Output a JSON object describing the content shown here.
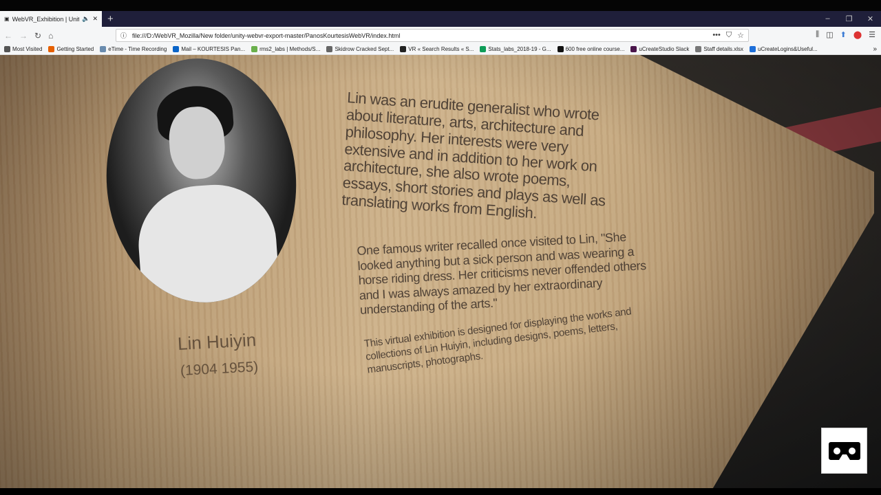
{
  "browser": {
    "tab_title": "WebVR_Exhibition | Unity-WebVR",
    "new_tab": "+",
    "url": "file:///D:/WebVR_Mozilla/New folder/unity-webvr-export-master/PanosKourtesisWebVR/index.html",
    "bookmarks": [
      {
        "label": "Most Visited",
        "color": "#555"
      },
      {
        "label": "Getting Started",
        "color": "#e66000"
      },
      {
        "label": "eTime - Time Recording",
        "color": "#6a8caf"
      },
      {
        "label": "Mail – KOURTESIS Pan...",
        "color": "#0a64c8"
      },
      {
        "label": "rms2_labs | Methods/S...",
        "color": "#6ab04c"
      },
      {
        "label": "Skidrow Cracked Sept...",
        "color": "#666"
      },
      {
        "label": "VR « Search Results « S...",
        "color": "#222"
      },
      {
        "label": "Stats_labs_2018-19 - G...",
        "color": "#0f9d58"
      },
      {
        "label": "600 free online course...",
        "color": "#111"
      },
      {
        "label": "uCreateStudio Slack",
        "color": "#4a154b"
      },
      {
        "label": "Staff details.xlsx",
        "color": "#777"
      },
      {
        "label": "uCreateLogins&Useful...",
        "color": "#1e6fd9"
      }
    ]
  },
  "exhibit": {
    "name": "Lin Huiyin",
    "years": "(1904  1955)",
    "paragraph1": "Lin was an erudite generalist who wrote about literature, arts, architecture and philosophy. Her interests were very extensive and in addition to her work on architecture, she also wrote poems, essays, short stories and plays as well as translating works from English.",
    "paragraph2": "One famous writer recalled once visited to Lin, \"She looked anything but a sick person and was wearing a horse riding dress. Her criticisms never offended others and I was always amazed by her extraordinary understanding of the arts.\"",
    "paragraph3": "This virtual exhibition is designed for displaying the works and collections of Lin Huiyin, including designs, poems, letters, manuscripts, photographs."
  }
}
